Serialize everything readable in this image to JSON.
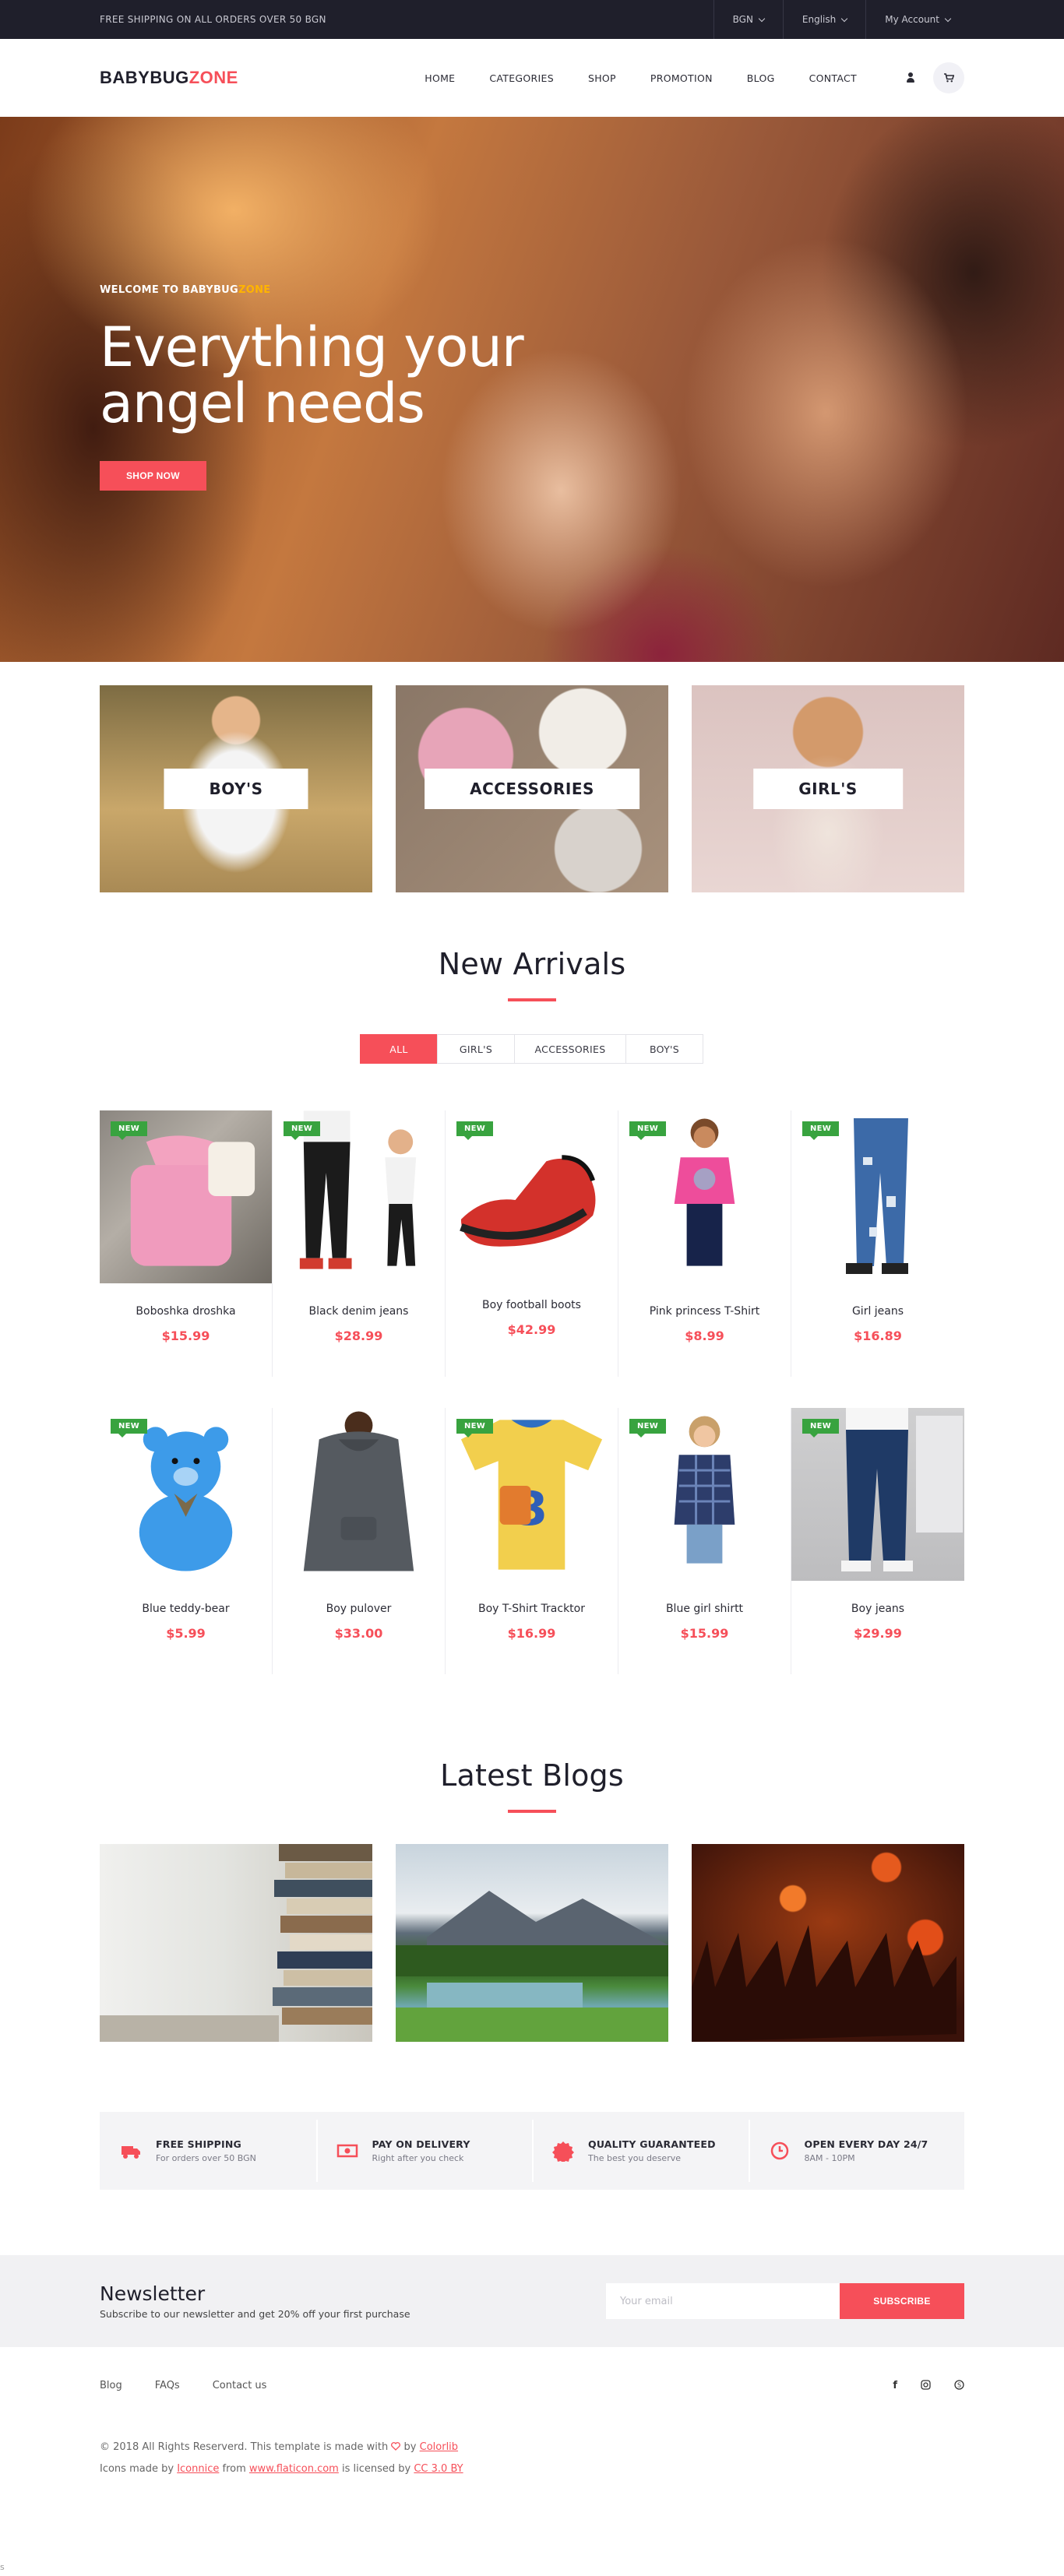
{
  "topbar": {
    "shipping_text": "FREE SHIPPING ON ALL ORDERS OVER 50 BGN",
    "currency": "BGN",
    "language": "English",
    "account": "My Account"
  },
  "header": {
    "logo_main": "BABYBUG",
    "logo_accent": "ZONE",
    "nav": [
      "HOME",
      "CATEGORIES",
      "SHOP",
      "PROMOTION",
      "BLOG",
      "CONTACT"
    ]
  },
  "hero": {
    "welcome_prefix": "WELCOME TO BABYBUG",
    "welcome_accent": "ZONE",
    "headline_line1": "Everything your",
    "headline_line2": "angel needs",
    "cta": "SHOP NOW"
  },
  "categories": [
    "BOY'S",
    "ACCESSORIES",
    "GIRL'S"
  ],
  "new_arrivals": {
    "title": "New Arrivals",
    "tabs": [
      "ALL",
      "GIRL'S",
      "ACCESSORIES",
      "BOY'S"
    ],
    "badge": "NEW",
    "products": [
      {
        "name": "Boboshka droshka",
        "price": "$15.99"
      },
      {
        "name": "Black denim jeans",
        "price": "$28.99"
      },
      {
        "name": "Boy football boots",
        "price": "$42.99"
      },
      {
        "name": "Pink princess T-Shirt",
        "price": "$8.99"
      },
      {
        "name": "Girl jeans",
        "price": "$16.89"
      },
      {
        "name": "Blue teddy-bear",
        "price": "$5.99"
      },
      {
        "name": "Boy pulover",
        "price": "$33.00"
      },
      {
        "name": "Boy T-Shirt Tracktor",
        "price": "$16.99"
      },
      {
        "name": "Blue girl shirtt",
        "price": "$15.99"
      },
      {
        "name": "Boy jeans",
        "price": "$29.99"
      }
    ]
  },
  "blogs": {
    "title": "Latest Blogs"
  },
  "features": [
    {
      "title": "FREE SHIPPING",
      "sub": "For orders over 50 BGN",
      "icon": "truck-icon"
    },
    {
      "title": "PAY ON DELIVERY",
      "sub": "Right after you check",
      "icon": "cash-icon"
    },
    {
      "title": "QUALITY GUARANTEED",
      "sub": "The best you deserve",
      "icon": "badge-icon"
    },
    {
      "title": "OPEN EVERY DAY 24/7",
      "sub": "8AM - 10PM",
      "icon": "clock-icon"
    }
  ],
  "newsletter": {
    "title": "Newsletter",
    "subtitle": "Subscribe to our newsletter and get 20% off your first purchase",
    "placeholder": "Your email",
    "button": "SUBSCRIBE"
  },
  "footer": {
    "links": [
      "Blog",
      "FAQs",
      "Contact us"
    ],
    "social": [
      "facebook-icon",
      "instagram-icon",
      "skype-icon"
    ],
    "copy_prefix": "© 2018 All Rights Reserverd. This template is made with",
    "copy_by": "by",
    "copy_brand": "Colorlib",
    "icons_prefix": "Icons made by",
    "icons_author": "Iconnice",
    "icons_from": "from",
    "icons_site": "www.flaticon.com",
    "icons_licensed": "is licensed by",
    "icons_license": "CC 3.0 BY"
  },
  "stray_char": "s",
  "colors": {
    "accent": "#f64f59",
    "badge": "#38a33f",
    "dark": "#1f1f2b",
    "yellow": "#ffb400"
  }
}
